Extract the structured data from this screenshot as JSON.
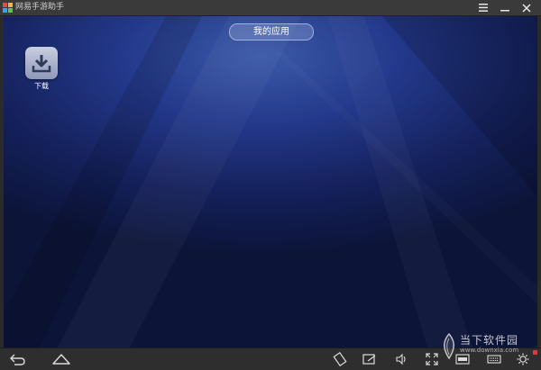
{
  "window": {
    "title": "网易手游助手"
  },
  "screen": {
    "section_title": "我的应用",
    "apps": [
      {
        "label": "下载",
        "icon": "download-icon"
      }
    ]
  },
  "navbar": {
    "left_buttons": [
      "back-icon",
      "home-icon"
    ],
    "right_buttons": [
      "rotate-icon",
      "screenshot-icon",
      "volume-icon",
      "fullscreen-icon",
      "apk-install-icon",
      "keyboard-icon",
      "settings-icon"
    ]
  },
  "watermark": {
    "text": "当下软件园",
    "url": "www.downxia.com"
  },
  "colors": {
    "titlebar": "#3a3a3a",
    "navbar": "#2e2e2e",
    "screen_top": "#3b5aa8",
    "screen_bottom": "#0c1438",
    "accent_red": "#e33333"
  }
}
